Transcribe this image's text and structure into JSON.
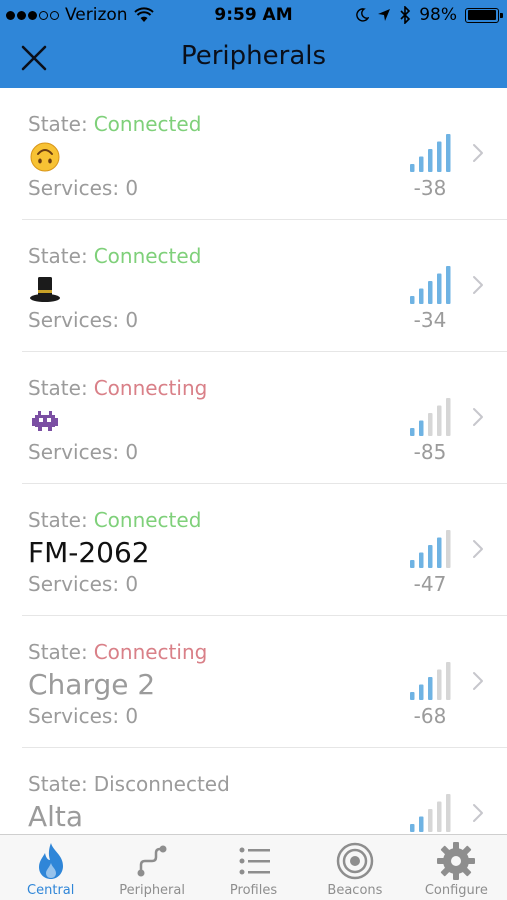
{
  "status_bar": {
    "carrier": "Verizon",
    "time": "9:59 AM",
    "battery": "98%",
    "battery_level": 0.98,
    "signal_dots_filled": 3,
    "signal_dots_total": 5
  },
  "nav": {
    "title": "Peripherals",
    "close_icon": "close-icon"
  },
  "colors": {
    "header": "#2f86d8",
    "connected": "#7fd07a",
    "connecting": "#d98088",
    "disconnected": "#9b9b9b",
    "signal_active": "#6fb3e3",
    "signal_inactive": "#d6d6d6",
    "tab_active": "#2f86d8"
  },
  "state_label": "State:",
  "peripherals": [
    {
      "state": "Connected",
      "status": "connected",
      "name": "",
      "name_icon": "upside-down-face-emoji",
      "name_dim": false,
      "services": "Services: 0",
      "rssi": "-38",
      "signal_bars": 5
    },
    {
      "state": "Connected",
      "status": "connected",
      "name": "",
      "name_icon": "top-hat-emoji",
      "name_dim": false,
      "services": "Services: 0",
      "rssi": "-34",
      "signal_bars": 5
    },
    {
      "state": "Connecting",
      "status": "connecting",
      "name": "",
      "name_icon": "alien-monster-emoji",
      "name_dim": false,
      "services": "Services: 0",
      "rssi": "-85",
      "signal_bars": 2
    },
    {
      "state": "Connected",
      "status": "connected",
      "name": "FM-2062",
      "name_icon": "",
      "name_dim": false,
      "services": "Services: 0",
      "rssi": "-47",
      "signal_bars": 4
    },
    {
      "state": "Connecting",
      "status": "connecting",
      "name": "Charge 2",
      "name_icon": "",
      "name_dim": true,
      "services": "Services: 0",
      "rssi": "-68",
      "signal_bars": 3
    },
    {
      "state": "Disconnected",
      "status": "disconnected",
      "name": "Alta",
      "name_icon": "",
      "name_dim": true,
      "services": "",
      "rssi": "",
      "signal_bars": 2
    }
  ],
  "tabs": [
    {
      "label": "Central",
      "icon": "flame-icon",
      "active": true
    },
    {
      "label": "Peripheral",
      "icon": "peripheral-icon",
      "active": false
    },
    {
      "label": "Profiles",
      "icon": "list-icon",
      "active": false
    },
    {
      "label": "Beacons",
      "icon": "beacon-icon",
      "active": false
    },
    {
      "label": "Configure",
      "icon": "gear-icon",
      "active": false
    }
  ]
}
